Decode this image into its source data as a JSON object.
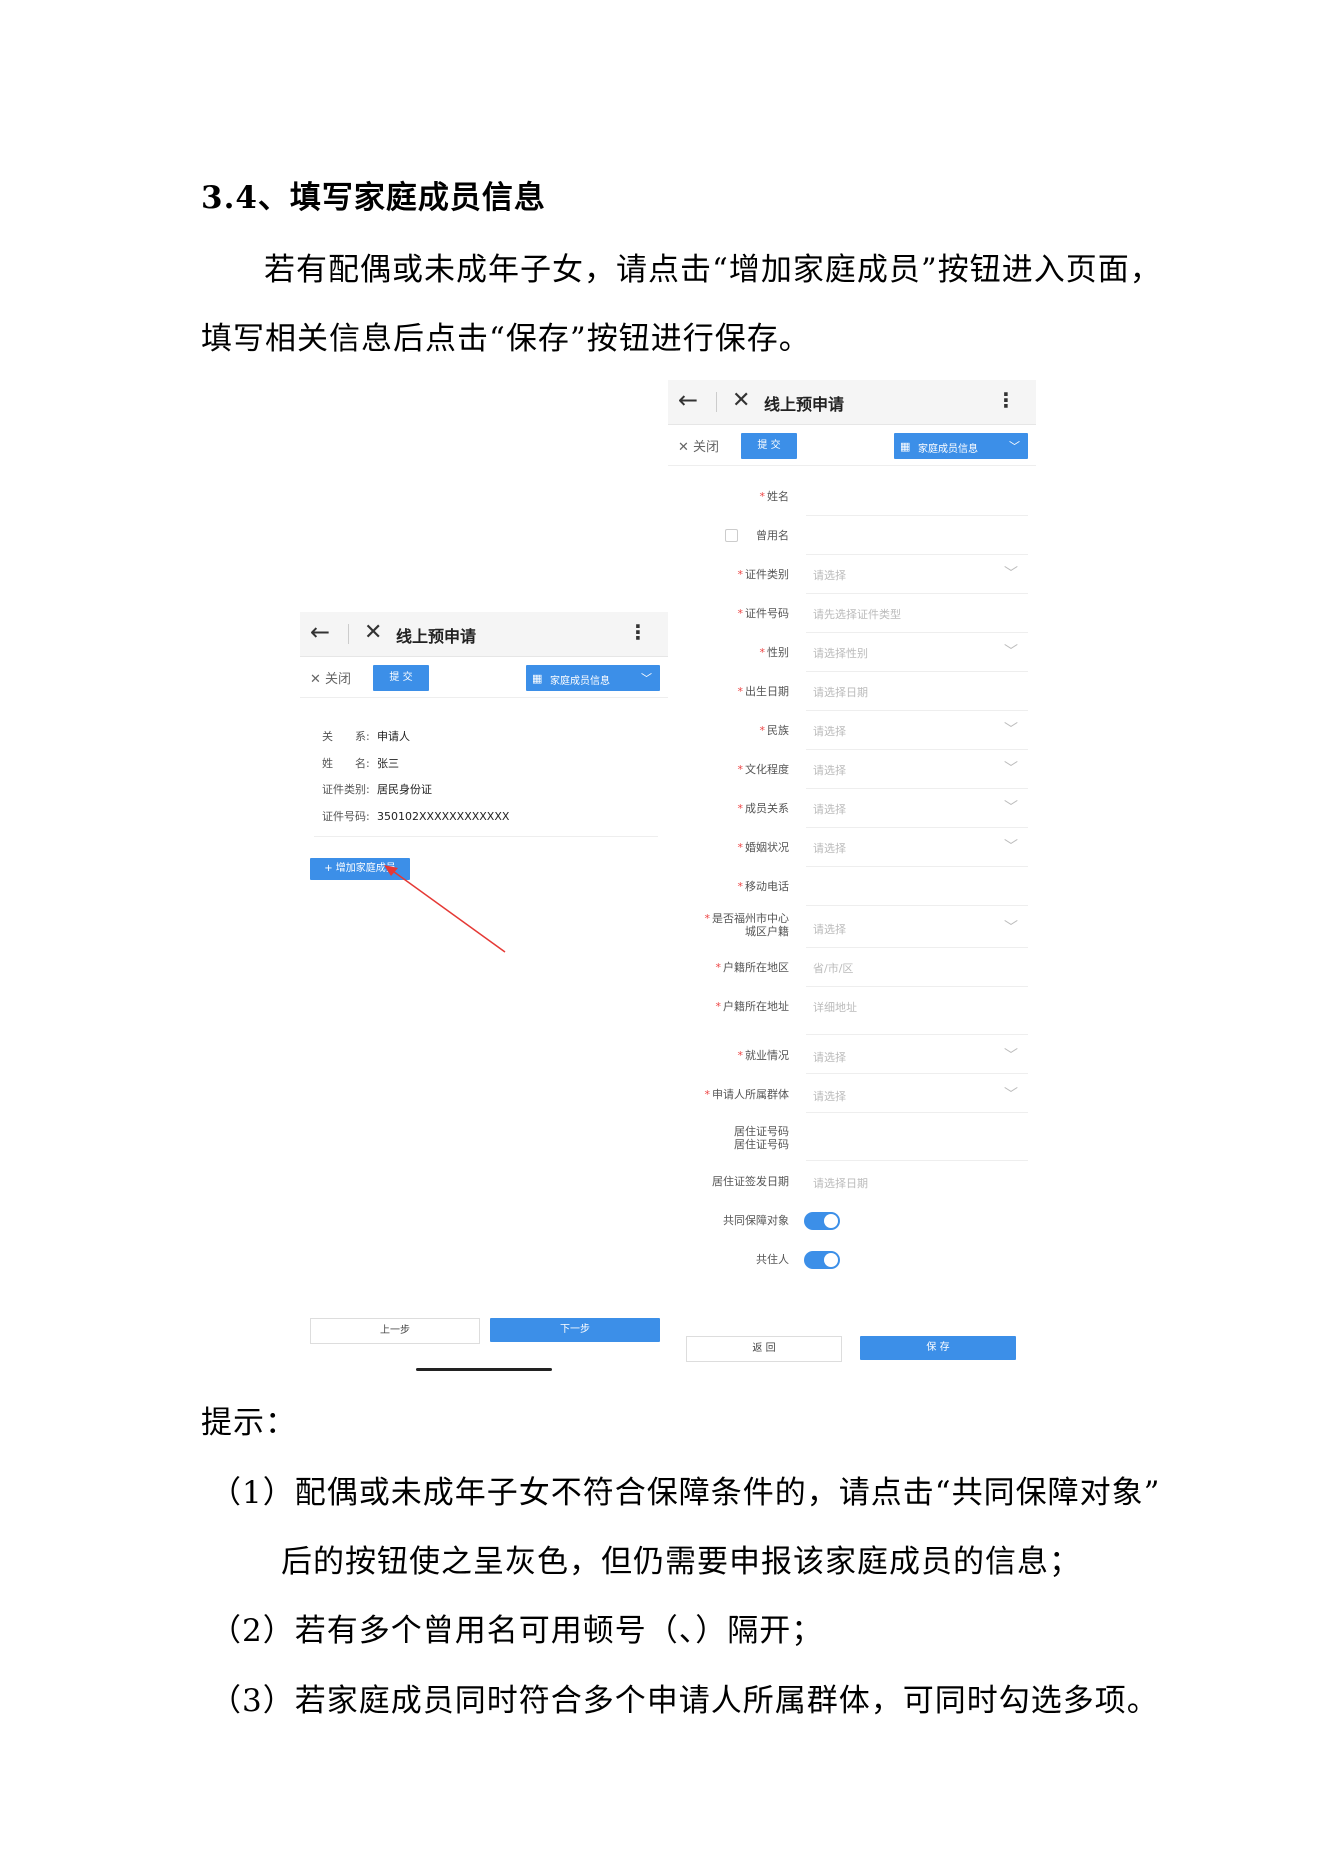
{
  "heading": "3.4、填写家庭成员信息",
  "intro": {
    "line1": "若有配偶或未成年子女，请点击“增加家庭成员”按钮进入页面，",
    "line2": "填写相关信息后点击“保存”按钮进行保存。"
  },
  "left_screen": {
    "title": "线上预申请",
    "close": "关闭",
    "submit": "提 交",
    "dropdown": "家庭成员信息",
    "info": [
      {
        "key": "关　　系:",
        "value": "申请人"
      },
      {
        "key": "姓　　名:",
        "value": "张三"
      },
      {
        "key": "证件类别:",
        "value": "居民身份证"
      },
      {
        "key": "证件号码:",
        "value": "350102XXXXXXXXXXXX"
      }
    ],
    "add_member": "+ 增加家庭成员",
    "prev": "上一步",
    "next": "下一步"
  },
  "right_screen": {
    "title": "线上预申请",
    "close": "关闭",
    "submit": "提 交",
    "dropdown": "家庭成员信息",
    "fields": {
      "name": "姓名",
      "former_name": "曾用名",
      "id_type": {
        "label": "证件类别",
        "placeholder": "请选择"
      },
      "id_number": {
        "label": "证件号码",
        "placeholder": "请先选择证件类型"
      },
      "gender": {
        "label": "性别",
        "placeholder": "请选择性别"
      },
      "birth": {
        "label": "出生日期",
        "placeholder": "请选择日期"
      },
      "ethnicity": {
        "label": "民族",
        "placeholder": "请选择"
      },
      "education": {
        "label": "文化程度",
        "placeholder": "请选择"
      },
      "relation": {
        "label": "成员关系",
        "placeholder": "请选择"
      },
      "marital": {
        "label": "婚姻状况",
        "placeholder": "请选择"
      },
      "mobile": "移动电话",
      "fuzhou": {
        "label1": "是否福州市中心",
        "label2": "城区户籍",
        "placeholder": "请选择"
      },
      "hukou_region": {
        "label": "户籍所在地区",
        "placeholder": "省/市/区"
      },
      "hukou_address": {
        "label": "户籍所在地址",
        "placeholder": "详细地址"
      },
      "employment": {
        "label": "就业情况",
        "placeholder": "请选择"
      },
      "group": {
        "label": "申请人所属群体",
        "placeholder": "请选择"
      },
      "residence_permit": {
        "label1": "居住证号码",
        "label2": "居住证号码"
      },
      "permit_date": {
        "label": "居住证签发日期",
        "placeholder": "请选择日期"
      },
      "joint": "共同保障对象",
      "cohabitant": "共住人"
    },
    "back": "返 回",
    "save": "保 存"
  },
  "tips": {
    "title": "提示：",
    "t1a": "（1）配偶或未成年子女不符合保障条件的，请点击“共同保障对象”",
    "t1b": "后的按钮使之呈灰色，但仍需要申报该家庭成员的信息；",
    "t2": "（2）若有多个曾用名可用顿号（、）隔开；",
    "t3": "（3）若家庭成员同时符合多个申请人所属群体，可同时勾选多项。"
  },
  "colors": {
    "accent": "#3c8fe8",
    "arrow": "#e53935",
    "required": "#ee4444"
  }
}
